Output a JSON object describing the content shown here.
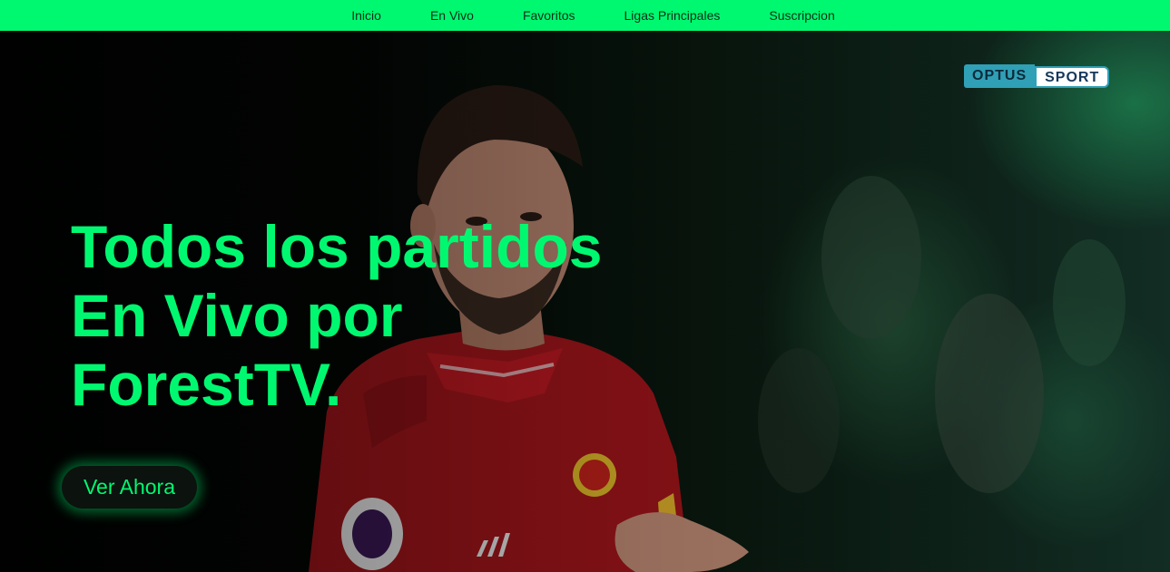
{
  "nav": {
    "items": [
      {
        "label": "Inicio"
      },
      {
        "label": "En Vivo"
      },
      {
        "label": "Favoritos"
      },
      {
        "label": "Ligas Principales"
      },
      {
        "label": "Suscripcion"
      }
    ]
  },
  "hero": {
    "headline": "Todos los partidos En Vivo por ForestTV.",
    "cta_label": "Ver Ahora",
    "logo": {
      "part1": "OPTUS",
      "part2": "SPORT"
    }
  },
  "colors": {
    "accent": "#00f870",
    "background": "#000000",
    "cta_background": "#0c120e"
  }
}
